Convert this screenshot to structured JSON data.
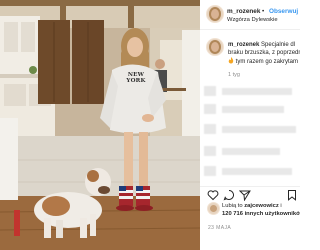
{
  "post": {
    "username": "m_rozenek",
    "separator": "•",
    "follow_label": "Obserwuj",
    "location": "Wzgórza Dylewskie",
    "shirt_text": "NEW YORK"
  },
  "caption": {
    "username": "m_rozenek",
    "line1_text": "Specjalnie dl",
    "line2_text": "braku brzuszka, z poprzedn",
    "line3_text": "tym razem go zakrytam",
    "age": "1 tyg"
  },
  "likes": {
    "line1_prefix": "Lubią to ",
    "line1_user": "zajcewowicz",
    "line1_suffix": " i",
    "line2_count": "120 716 innych użytkowników"
  },
  "date_label": "23 MAJA",
  "colors": {
    "follow_blue": "#3897f0",
    "text_primary": "#262626",
    "text_secondary": "#8e8e8e",
    "flame": "#f5a623"
  },
  "icons": [
    "heart-icon",
    "comment-icon",
    "share-icon",
    "bookmark-icon",
    "flame-icon"
  ]
}
